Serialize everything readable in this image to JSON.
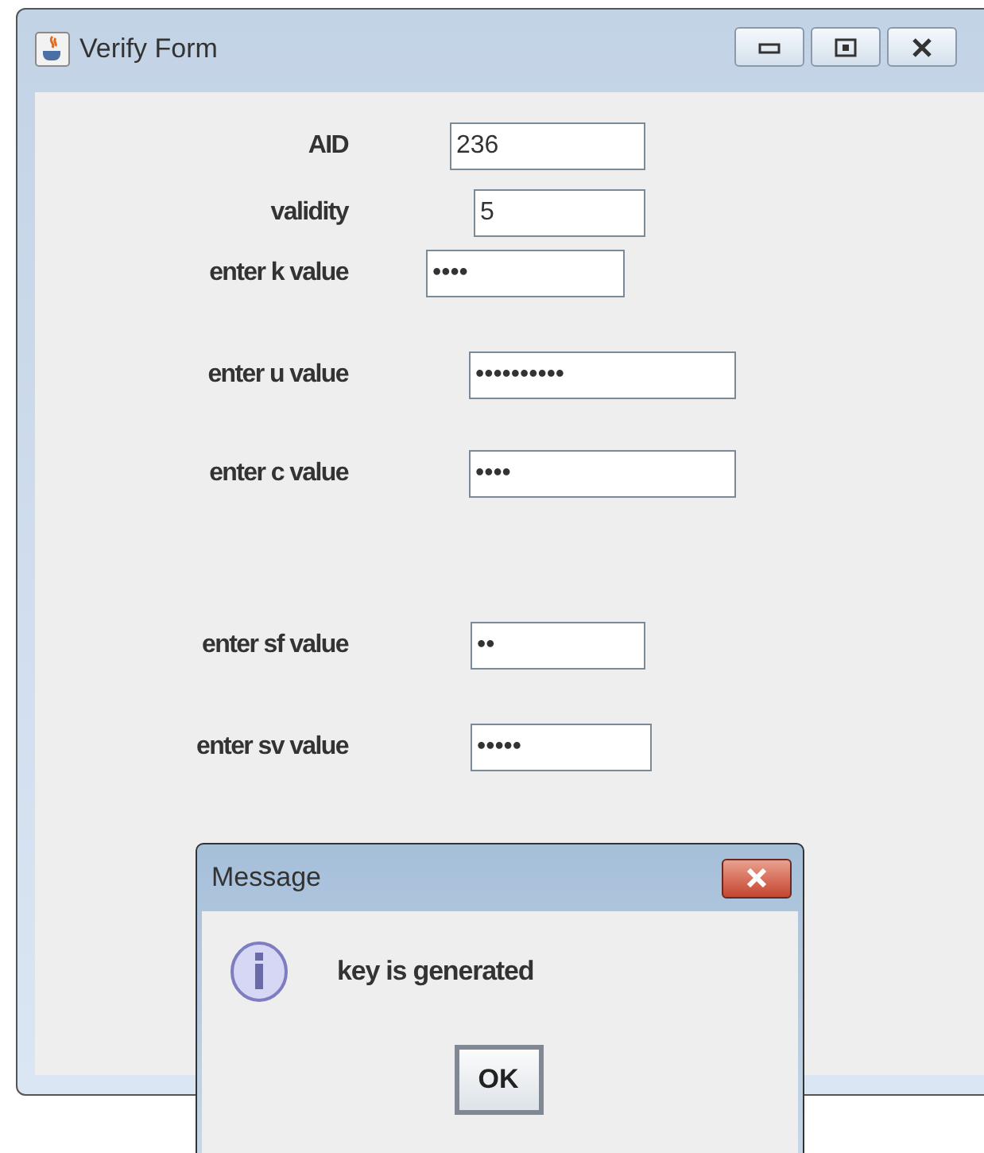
{
  "window": {
    "title": "Verify Form"
  },
  "fields": [
    {
      "label": "AID",
      "value": "236"
    },
    {
      "label": "validity",
      "value": "5"
    },
    {
      "label": "enter k value",
      "value": "••••"
    },
    {
      "label": "enter u value",
      "value": "••••••••••"
    },
    {
      "label": "enter c value",
      "value": "••••"
    },
    {
      "label": "enter sf value",
      "value": "••"
    },
    {
      "label": "enter sv value",
      "value": "•••••"
    }
  ],
  "dialog": {
    "title": "Message",
    "message": "key is generated",
    "button": "OK"
  }
}
